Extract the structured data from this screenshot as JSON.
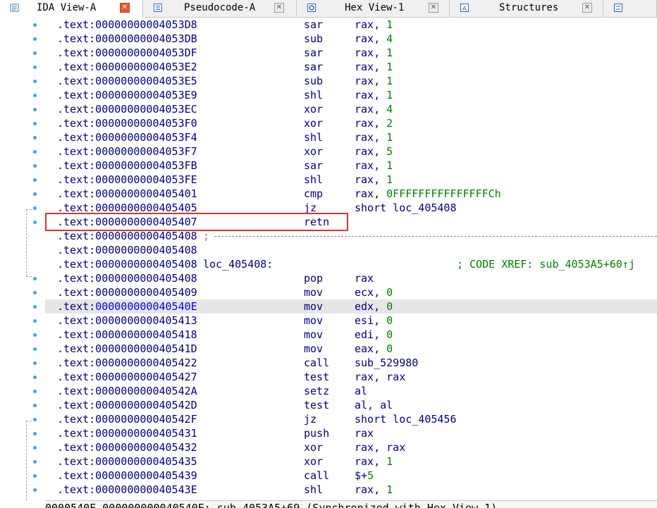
{
  "tabs": [
    {
      "label": "IDA View-A",
      "icon": "disassembly-icon",
      "active": true,
      "closable": true
    },
    {
      "label": "Pseudocode-A",
      "icon": "pseudocode-icon",
      "active": false,
      "closable": true
    },
    {
      "label": "Hex View-1",
      "icon": "hex-view-icon",
      "active": false,
      "closable": true
    },
    {
      "label": "Structures",
      "icon": "structures-icon",
      "active": false,
      "closable": true
    },
    {
      "label": "",
      "icon": "enums-icon",
      "active": false,
      "closable": false
    }
  ],
  "listing": [
    {
      "addr": ".text:00000000004053D8",
      "mnem": "sar",
      "op1": "rax, ",
      "op2": "1"
    },
    {
      "addr": ".text:00000000004053DB",
      "mnem": "sub",
      "op1": "rax, ",
      "op2": "4"
    },
    {
      "addr": ".text:00000000004053DF",
      "mnem": "sar",
      "op1": "rax, ",
      "op2": "1"
    },
    {
      "addr": ".text:00000000004053E2",
      "mnem": "sar",
      "op1": "rax, ",
      "op2": "1"
    },
    {
      "addr": ".text:00000000004053E5",
      "mnem": "sub",
      "op1": "rax, ",
      "op2": "1"
    },
    {
      "addr": ".text:00000000004053E9",
      "mnem": "shl",
      "op1": "rax, ",
      "op2": "1"
    },
    {
      "addr": ".text:00000000004053EC",
      "mnem": "xor",
      "op1": "rax, ",
      "op2": "4"
    },
    {
      "addr": ".text:00000000004053F0",
      "mnem": "xor",
      "op1": "rax, ",
      "op2": "2"
    },
    {
      "addr": ".text:00000000004053F4",
      "mnem": "shl",
      "op1": "rax, ",
      "op2": "1"
    },
    {
      "addr": ".text:00000000004053F7",
      "mnem": "xor",
      "op1": "rax, ",
      "op2": "5"
    },
    {
      "addr": ".text:00000000004053FB",
      "mnem": "sar",
      "op1": "rax, ",
      "op2": "1"
    },
    {
      "addr": ".text:00000000004053FE",
      "mnem": "shl",
      "op1": "rax, ",
      "op2": "1"
    },
    {
      "addr": ".text:0000000000405401",
      "mnem": "cmp",
      "op1": "rax, ",
      "op2": "0FFFFFFFFFFFFFFFCh"
    },
    {
      "addr": ".text:0000000000405405",
      "mnem": "jz",
      "op1": "short loc_405408",
      "op2": ""
    },
    {
      "addr": ".text:0000000000405407",
      "mnem": "retn",
      "op1": "",
      "op2": ""
    },
    {
      "addr": ".text:0000000000405408",
      "semi": ";",
      "separator": true
    },
    {
      "addr": ".text:0000000000405408"
    },
    {
      "addr": ".text:0000000000405408",
      "label": "loc_405408:",
      "xref": "; CODE XREF: sub_4053A5+60↑j"
    },
    {
      "addr": ".text:0000000000405408",
      "mnem": "pop",
      "op1": "rax",
      "op2": ""
    },
    {
      "addr": ".text:0000000000405409",
      "mnem": "mov",
      "op1": "ecx, ",
      "op2": "0"
    },
    {
      "addr": ".text:",
      "addr_num": "000000000040540E",
      "mnem": "mov",
      "op1": "edx, ",
      "op2": "0",
      "highlight": true
    },
    {
      "addr": ".text:0000000000405413",
      "mnem": "mov",
      "op1": "esi, ",
      "op2": "0"
    },
    {
      "addr": ".text:0000000000405418",
      "mnem": "mov",
      "op1": "edi, ",
      "op2": "0"
    },
    {
      "addr": ".text:000000000040541D",
      "mnem": "mov",
      "op1": "eax, ",
      "op2": "0"
    },
    {
      "addr": ".text:0000000000405422",
      "mnem": "call",
      "op1": "sub_529980",
      "op2": ""
    },
    {
      "addr": ".text:0000000000405427",
      "mnem": "test",
      "op1": "rax, rax",
      "op2": ""
    },
    {
      "addr": ".text:000000000040542A",
      "mnem": "setz",
      "op1": "al",
      "op2": ""
    },
    {
      "addr": ".text:000000000040542D",
      "mnem": "test",
      "op1": "al, al",
      "op2": ""
    },
    {
      "addr": ".text:000000000040542F",
      "mnem": "jz",
      "op1": "short loc_405456",
      "op2": ""
    },
    {
      "addr": ".text:0000000000405431",
      "mnem": "push",
      "op1": "rax",
      "op2": ""
    },
    {
      "addr": ".text:0000000000405432",
      "mnem": "xor",
      "op1": "rax, rax",
      "op2": ""
    },
    {
      "addr": ".text:0000000000405435",
      "mnem": "xor",
      "op1": "rax, ",
      "op2": "1"
    },
    {
      "addr": ".text:0000000000405439",
      "mnem": "call",
      "op1": "$+",
      "op2": "5"
    },
    {
      "addr": ".text:000000000040543E",
      "mnem": "shl",
      "op1": "rax, ",
      "op2": "1"
    }
  ],
  "statusbar": {
    "text": "0000540E 000000000040540E: sub_4053A5+69 (Synchronized with Hex View-1)"
  },
  "colors": {
    "address": "#000080",
    "immediate": "#008000",
    "xref": "#008000",
    "breakpoint_dot": "#3ba3e8",
    "selection_box": "#e03030"
  }
}
